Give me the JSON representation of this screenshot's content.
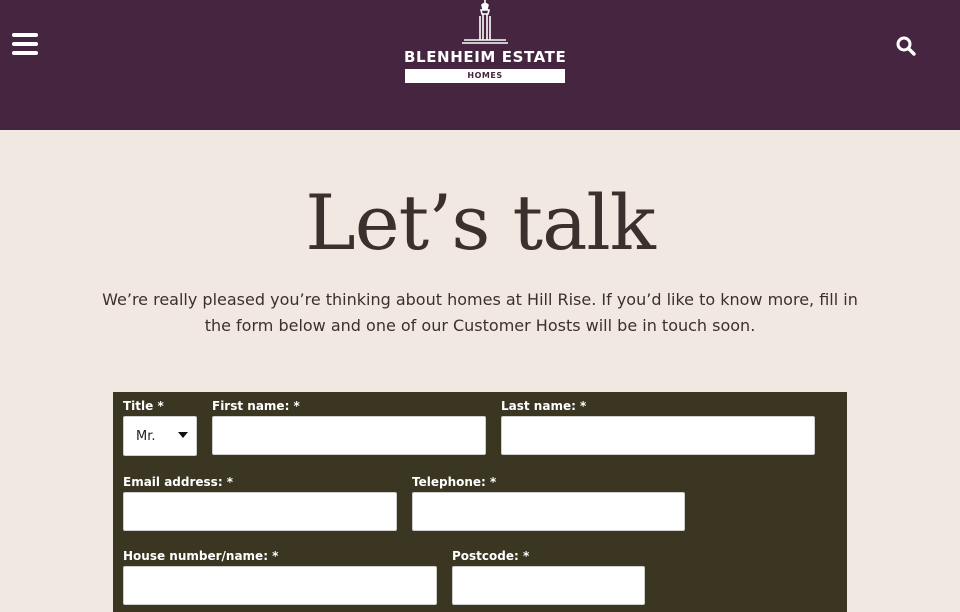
{
  "header": {
    "menu_icon": "hamburger-menu-icon",
    "search_icon": "search-icon",
    "logo": {
      "name": "BLENHEIM ESTATE",
      "sub": "HOMES"
    },
    "background": "#45253f"
  },
  "main": {
    "heading": "Let’s talk",
    "intro": "We’re really pleased you’re thinking about homes at Hill Rise. If you’d like to know more, fill in the form below and one of our Customer Hosts will be in touch soon.",
    "background": "#f2e8e2"
  },
  "form": {
    "background": "#3a3622",
    "title": {
      "label": "Title *",
      "value": "Mr."
    },
    "first_name": {
      "label": "First name: *",
      "value": ""
    },
    "last_name": {
      "label": "Last name: *",
      "value": ""
    },
    "email": {
      "label": "Email address: *",
      "value": ""
    },
    "telephone": {
      "label": "Telephone: *",
      "value": ""
    },
    "house": {
      "label": "House number/name: *",
      "value": ""
    },
    "postcode": {
      "label": "Postcode: *",
      "value": ""
    }
  }
}
